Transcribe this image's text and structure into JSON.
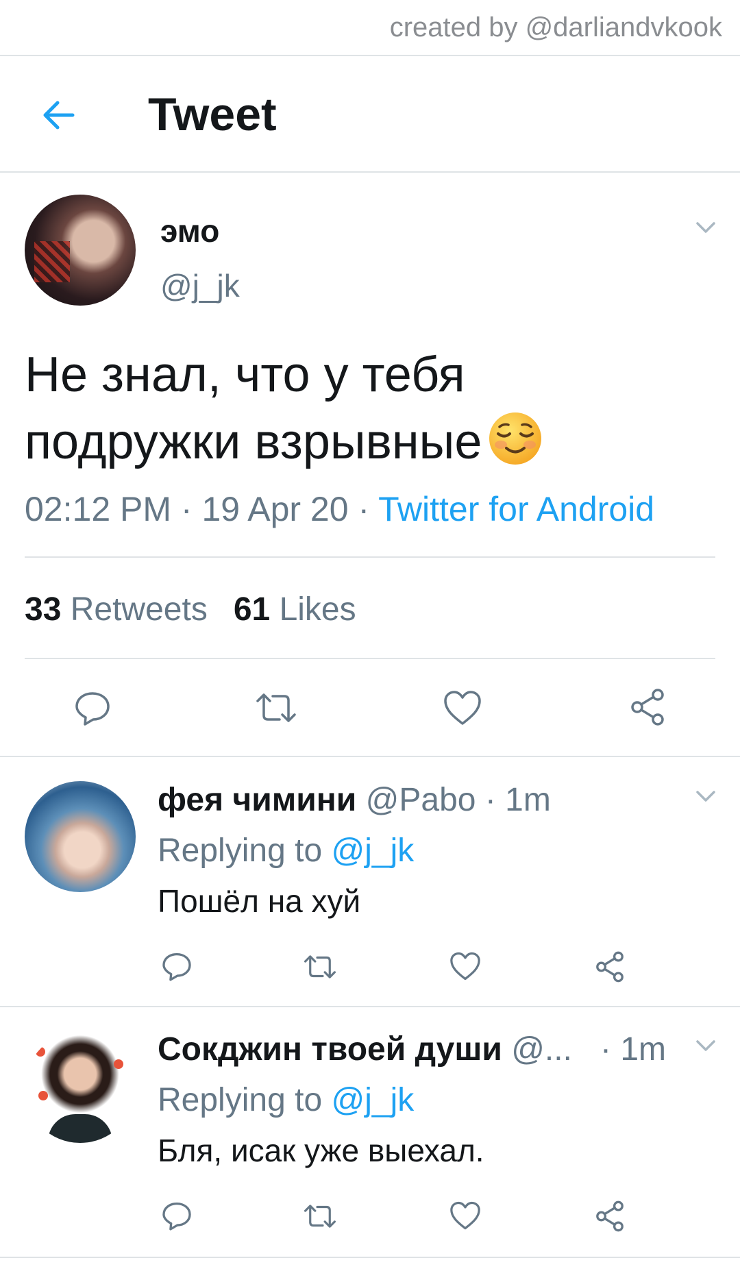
{
  "credit": "created by @darliandvkook",
  "header": {
    "title": "Tweet",
    "back_icon": "arrow-left-icon"
  },
  "tweet": {
    "name": "эмо",
    "handle": "@j_jk",
    "text_line1": "Не знал, что у тебя",
    "text_line2": "подружки взрывные",
    "time": "02:12 PM",
    "date": "19 Apr 20",
    "source": "Twitter for Android",
    "sep": "·",
    "retweets_count": "33",
    "retweets_label": "Retweets",
    "likes_count": "61",
    "likes_label": "Likes"
  },
  "replies": [
    {
      "name": "фея чимини",
      "handle": "@Pabo",
      "sep": "·",
      "time": "1m",
      "replying_label": "Replying to",
      "replying_to": "@j_jk",
      "text": "Пошёл на хуй"
    },
    {
      "name": "Сокджин твоей души",
      "handle": "@...",
      "sep": "·",
      "time": "1m",
      "replying_label": "Replying to",
      "replying_to": "@j_jk",
      "text": "Бля, исак уже выехал."
    }
  ],
  "colors": {
    "accent": "#1da1f2",
    "muted": "#657786",
    "divider": "#dfe3e6",
    "icon": "#657786"
  },
  "icons": [
    "arrow-left-icon",
    "chevron-down-icon",
    "reply-icon",
    "retweet-icon",
    "like-icon",
    "share-icon",
    "smiling-face-emoji"
  ]
}
